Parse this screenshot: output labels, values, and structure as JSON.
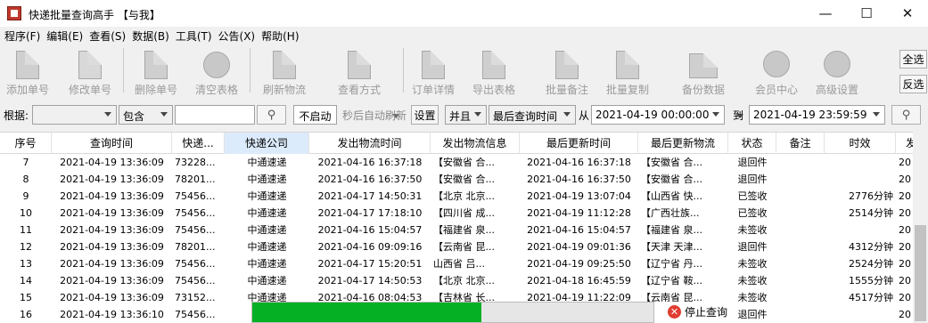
{
  "window": {
    "title": "快递批量查询高手 【与我】",
    "minimize": "—",
    "maximize": "☐",
    "close": "✕"
  },
  "menu": [
    "程序(F)",
    "编辑(E)",
    "查看(S)",
    "数据(B)",
    "工具(T)",
    "公告(X)",
    "帮助(H)"
  ],
  "toolbar": {
    "add": "添加单号",
    "edit": "修改单号",
    "delete": "删除单号",
    "clear": "清空表格",
    "refresh": "刷新物流",
    "view_mode": "查看方式",
    "order_detail": "订单详情",
    "export": "导出表格",
    "batch_note": "批量备注",
    "batch_copy": "批量复制",
    "backup": "备份数据",
    "member": "会员中心",
    "advanced": "高级设置",
    "select_all": "全选",
    "invert": "反选"
  },
  "filter": {
    "label": "根据:",
    "field_value": "",
    "match_value": "包含",
    "keyword_value": "",
    "auto_refresh_value": "不启动",
    "auto_refresh_label": "秒后自动刷新",
    "settings": "设置",
    "logic_value": "并且",
    "time_field_value": "最后查询时间",
    "from_label": "从",
    "from_value": "2021-04-19 00:00:00",
    "to_label": "到",
    "to_value": "2021-04-19 23:59:59"
  },
  "table": {
    "headers": [
      "序号",
      "查询时间",
      "快递...",
      "快递公司",
      "发出物流时间",
      "发出物流信息",
      "最后更新时间",
      "最后更新物流",
      "状态",
      "备注",
      "时效",
      "发"
    ],
    "rows": [
      [
        "7",
        "2021-04-19 13:36:09",
        "73228...",
        "中通速递",
        "2021-04-16 16:37:18",
        "【安徽省 合...",
        "2021-04-16 16:37:18",
        "【安徽省 合...",
        "退回件",
        "",
        "",
        "20"
      ],
      [
        "8",
        "2021-04-19 13:36:09",
        "78201...",
        "中通速递",
        "2021-04-16 16:37:50",
        "【安徽省 合...",
        "2021-04-16 16:37:50",
        "【安徽省 合...",
        "退回件",
        "",
        "",
        "20"
      ],
      [
        "9",
        "2021-04-19 13:36:09",
        "75456...",
        "中通速递",
        "2021-04-17 14:50:31",
        "【北京 北京...",
        "2021-04-19 13:07:04",
        "【山西省 快...",
        "已签收",
        "",
        "2776分钟",
        "20"
      ],
      [
        "10",
        "2021-04-19 13:36:09",
        "75456...",
        "中通速递",
        "2021-04-17 17:18:10",
        "【四川省 成...",
        "2021-04-19 11:12:28",
        "【广西壮族...",
        "已签收",
        "",
        "2514分钟",
        "20"
      ],
      [
        "11",
        "2021-04-19 13:36:09",
        "75456...",
        "中通速递",
        "2021-04-16 15:04:57",
        "【福建省 泉...",
        "2021-04-16 15:04:57",
        "【福建省 泉...",
        "未签收",
        "",
        "",
        "20"
      ],
      [
        "12",
        "2021-04-19 13:36:09",
        "78201...",
        "中通速递",
        "2021-04-16 09:09:16",
        "【云南省 昆...",
        "2021-04-19 09:01:36",
        "【天津 天津...",
        "退回件",
        "",
        "4312分钟",
        "20"
      ],
      [
        "13",
        "2021-04-19 13:36:09",
        "75456...",
        "中通速递",
        "2021-04-17 15:20:51",
        "山西省 吕...",
        "2021-04-19 09:25:50",
        "【辽宁省 丹...",
        "未签收",
        "",
        "2524分钟",
        "20"
      ],
      [
        "14",
        "2021-04-19 13:36:09",
        "75456...",
        "中通速递",
        "2021-04-17 14:50:53",
        "【北京 北京...",
        "2021-04-18 16:45:59",
        "【辽宁省 鞍...",
        "未签收",
        "",
        "1555分钟",
        "20"
      ],
      [
        "15",
        "2021-04-19 13:36:09",
        "73152...",
        "中通速递",
        "2021-04-16 08:04:53",
        "【吉林省 长...",
        "2021-04-19 11:22:09",
        "【云南省 昆...",
        "未签收",
        "",
        "4517分钟",
        "20"
      ],
      [
        "16",
        "2021-04-19 13:36:10",
        "75456...",
        "中",
        "",
        "",
        "",
        "",
        "退回件",
        "",
        "",
        "20"
      ]
    ]
  },
  "progress": {
    "percent": 57
  },
  "stop_query": "停止查询"
}
